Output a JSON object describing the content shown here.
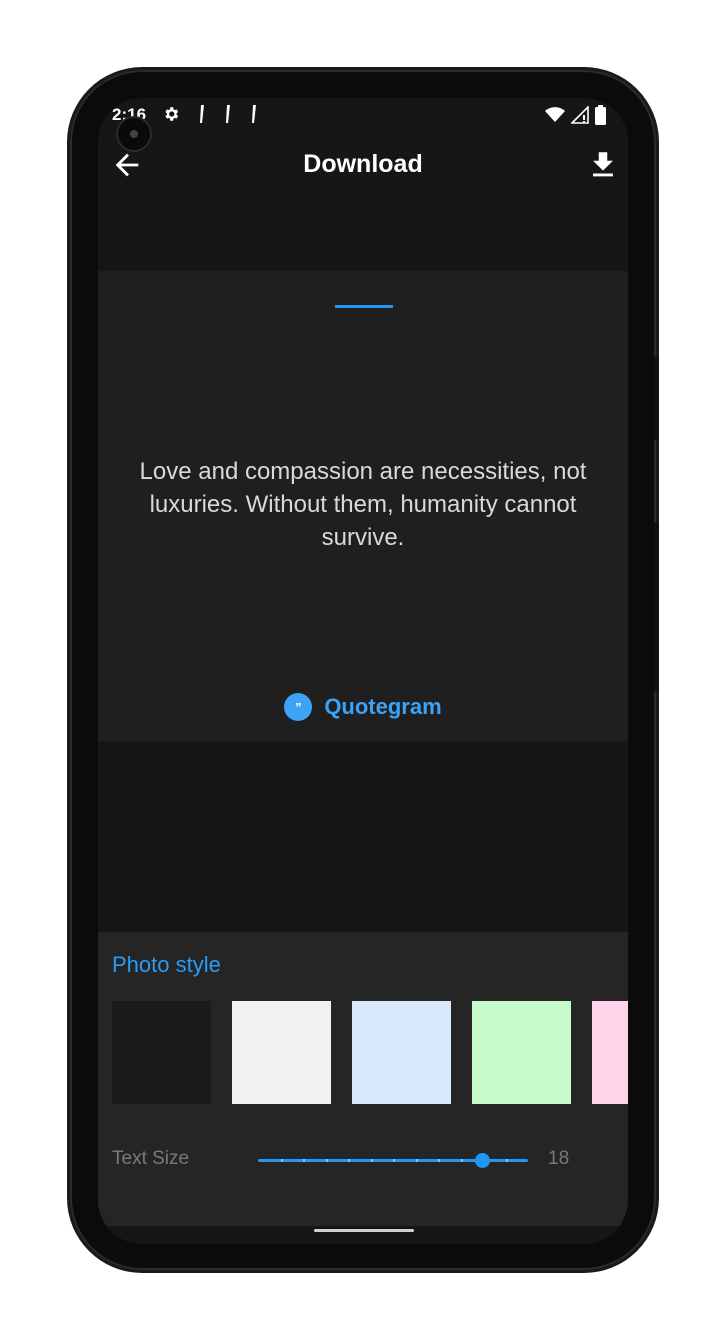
{
  "status_bar": {
    "time": "2:16",
    "left_icons": [
      "gear-icon",
      "notification-icon",
      "notification-icon",
      "notification-icon"
    ],
    "right_icons": [
      "wifi-icon",
      "signal-icon",
      "battery-icon"
    ]
  },
  "app_bar": {
    "title": "Download",
    "back_icon": "arrow-left-icon",
    "action_icon": "download-icon"
  },
  "quote_card": {
    "text": "Love and compassion are necessities, not luxuries. Without them, humanity cannot survive.",
    "brand": "Quotegram",
    "brand_icon": "quote-icon",
    "accent_color": "#2196f3"
  },
  "photo_style": {
    "title": "Photo style",
    "swatches": [
      {
        "color": "#1a1a1a"
      },
      {
        "color": "#f1f1f1"
      },
      {
        "color": "#dbe9ff"
      },
      {
        "color": "#c8fbcc"
      },
      {
        "color": "#ffd4e8"
      }
    ]
  },
  "text_size": {
    "label": "Text Size",
    "value": "18",
    "fraction": 0.83
  }
}
